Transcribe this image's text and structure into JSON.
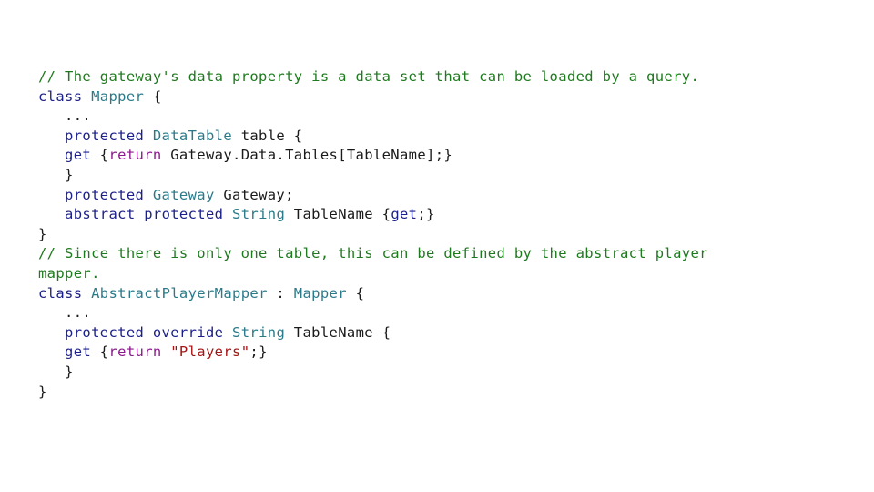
{
  "colors": {
    "comment": "#1e7a1e",
    "keyword": "#1b1f8a",
    "control": "#8b1a8b",
    "type": "#2b7a8a",
    "string": "#a31515",
    "plain": "#1a1a1a",
    "background": "#ffffff"
  },
  "code": {
    "lines": [
      [
        {
          "t": "comment",
          "v": "// The gateway's data property is a data set that can be loaded by a query."
        }
      ],
      [
        {
          "t": "keyword",
          "v": "class"
        },
        {
          "t": "plain",
          "v": " "
        },
        {
          "t": "type",
          "v": "Mapper"
        },
        {
          "t": "plain",
          "v": " {"
        }
      ],
      [
        {
          "t": "plain",
          "v": "   ..."
        }
      ],
      [
        {
          "t": "plain",
          "v": "   "
        },
        {
          "t": "keyword",
          "v": "protected"
        },
        {
          "t": "plain",
          "v": " "
        },
        {
          "t": "type",
          "v": "DataTable"
        },
        {
          "t": "plain",
          "v": " table {"
        }
      ],
      [
        {
          "t": "plain",
          "v": "   "
        },
        {
          "t": "keyword",
          "v": "get"
        },
        {
          "t": "plain",
          "v": " {"
        },
        {
          "t": "control",
          "v": "return"
        },
        {
          "t": "plain",
          "v": " Gateway.Data.Tables[TableName];}"
        }
      ],
      [
        {
          "t": "plain",
          "v": "   }"
        }
      ],
      [
        {
          "t": "plain",
          "v": "   "
        },
        {
          "t": "keyword",
          "v": "protected"
        },
        {
          "t": "plain",
          "v": " "
        },
        {
          "t": "type",
          "v": "Gateway"
        },
        {
          "t": "plain",
          "v": " Gateway;"
        }
      ],
      [
        {
          "t": "plain",
          "v": "   "
        },
        {
          "t": "keyword",
          "v": "abstract"
        },
        {
          "t": "plain",
          "v": " "
        },
        {
          "t": "keyword",
          "v": "protected"
        },
        {
          "t": "plain",
          "v": " "
        },
        {
          "t": "type",
          "v": "String"
        },
        {
          "t": "plain",
          "v": " TableName {"
        },
        {
          "t": "keyword",
          "v": "get"
        },
        {
          "t": "plain",
          "v": ";}"
        }
      ],
      [
        {
          "t": "plain",
          "v": "}"
        }
      ],
      [
        {
          "t": "comment",
          "v": "// Since there is only one table, this can be defined by the abstract player"
        }
      ],
      [
        {
          "t": "comment",
          "v": "mapper."
        }
      ],
      [
        {
          "t": "keyword",
          "v": "class"
        },
        {
          "t": "plain",
          "v": " "
        },
        {
          "t": "type",
          "v": "AbstractPlayerMapper"
        },
        {
          "t": "plain",
          "v": " : "
        },
        {
          "t": "type",
          "v": "Mapper"
        },
        {
          "t": "plain",
          "v": " {"
        }
      ],
      [
        {
          "t": "plain",
          "v": "   ..."
        }
      ],
      [
        {
          "t": "plain",
          "v": "   "
        },
        {
          "t": "keyword",
          "v": "protected"
        },
        {
          "t": "plain",
          "v": " "
        },
        {
          "t": "keyword",
          "v": "override"
        },
        {
          "t": "plain",
          "v": " "
        },
        {
          "t": "type",
          "v": "String"
        },
        {
          "t": "plain",
          "v": " TableName {"
        }
      ],
      [
        {
          "t": "plain",
          "v": "   "
        },
        {
          "t": "keyword",
          "v": "get"
        },
        {
          "t": "plain",
          "v": " {"
        },
        {
          "t": "control",
          "v": "return"
        },
        {
          "t": "plain",
          "v": " "
        },
        {
          "t": "string",
          "v": "\"Players\""
        },
        {
          "t": "plain",
          "v": ";}"
        }
      ],
      [
        {
          "t": "plain",
          "v": "   }"
        }
      ],
      [
        {
          "t": "plain",
          "v": "}"
        }
      ]
    ]
  }
}
